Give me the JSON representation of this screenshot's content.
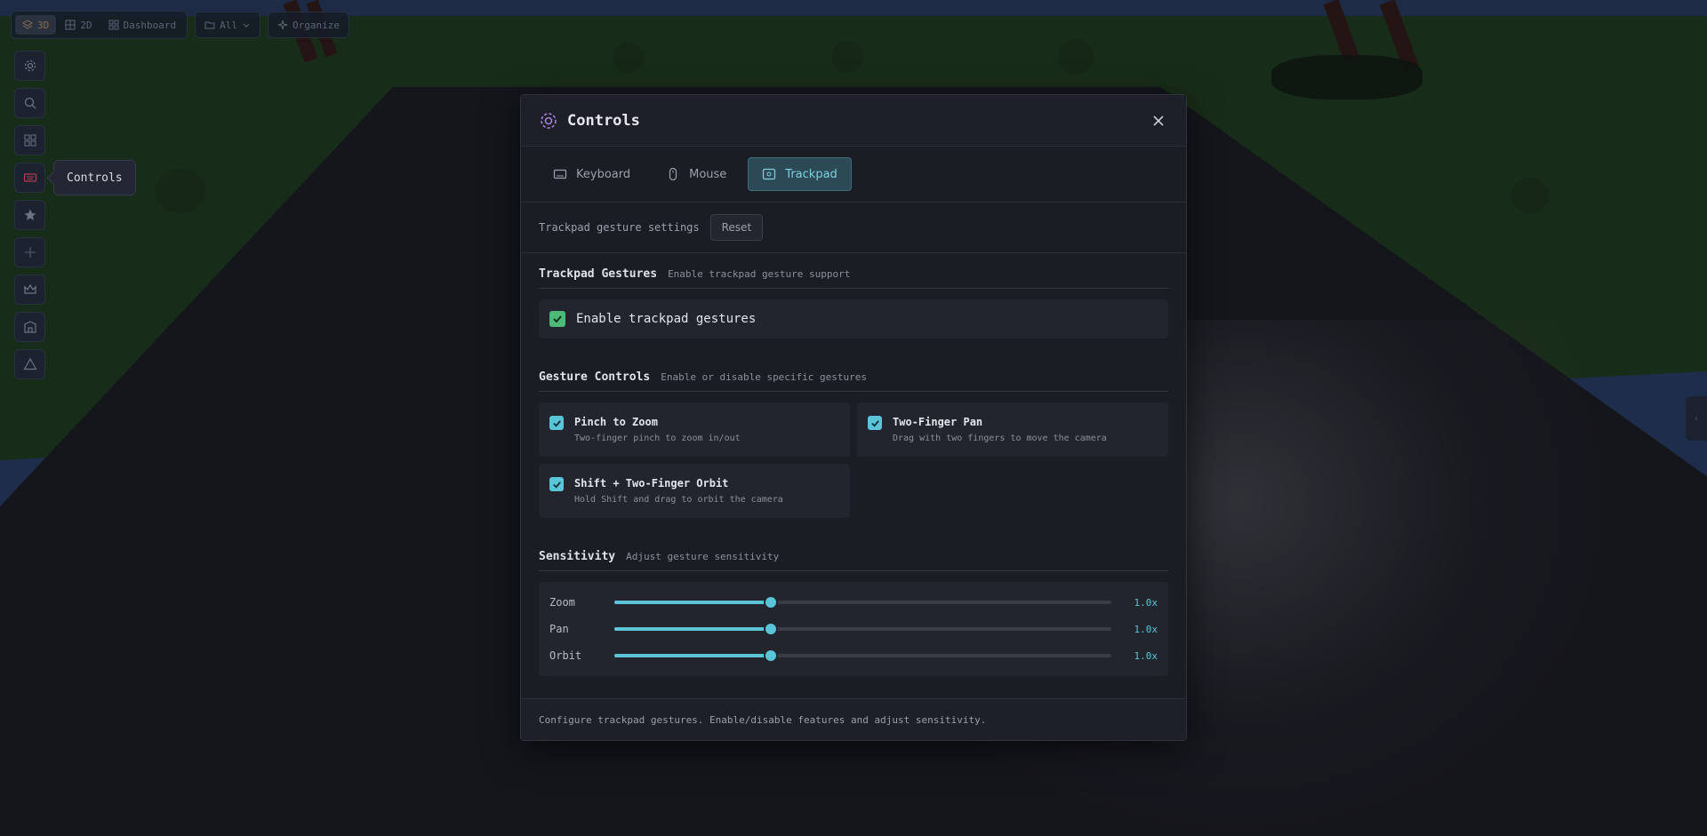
{
  "toolbar": {
    "view_modes": [
      "3D",
      "2D",
      "Dashboard"
    ],
    "filter_label": "All",
    "organize_label": "Organize"
  },
  "rail": {
    "tooltip": "Controls",
    "icons": [
      "gear-icon",
      "search-icon",
      "grid-icon",
      "keyboard-icon",
      "star-icon",
      "plus-icon",
      "crown-icon",
      "building-icon",
      "triangle-icon"
    ]
  },
  "modal": {
    "title": "Controls",
    "tabs": [
      {
        "label": "Keyboard",
        "icon": "keyboard-icon",
        "active": false
      },
      {
        "label": "Mouse",
        "icon": "mouse-icon",
        "active": false
      },
      {
        "label": "Trackpad",
        "icon": "trackpad-icon",
        "active": true
      }
    ],
    "settings_label": "Trackpad gesture settings",
    "reset_label": "Reset",
    "sections": {
      "gestures": {
        "title": "Trackpad Gestures",
        "subtitle": "Enable trackpad gesture support",
        "enable_label": "Enable trackpad gestures",
        "enabled": true
      },
      "controls": {
        "title": "Gesture Controls",
        "subtitle": "Enable or disable specific gestures",
        "items": [
          {
            "title": "Pinch to Zoom",
            "desc": "Two-finger pinch to zoom in/out",
            "checked": true
          },
          {
            "title": "Two-Finger Pan",
            "desc": "Drag with two fingers to move the camera",
            "checked": true
          },
          {
            "title": "Shift + Two-Finger Orbit",
            "desc": "Hold Shift and drag to orbit the camera",
            "checked": true
          }
        ]
      },
      "sensitivity": {
        "title": "Sensitivity",
        "subtitle": "Adjust gesture sensitivity",
        "sliders": [
          {
            "label": "Zoom",
            "value": "1.0x",
            "fraction": 0.315
          },
          {
            "label": "Pan",
            "value": "1.0x",
            "fraction": 0.315
          },
          {
            "label": "Orbit",
            "value": "1.0x",
            "fraction": 0.315
          }
        ]
      }
    },
    "footer": "Configure trackpad gestures. Enable/disable features and adjust sensitivity."
  },
  "colors": {
    "accent": "#5cc4d8",
    "check_green": "#4fb97a",
    "gear_icon": "#a87fd8"
  }
}
